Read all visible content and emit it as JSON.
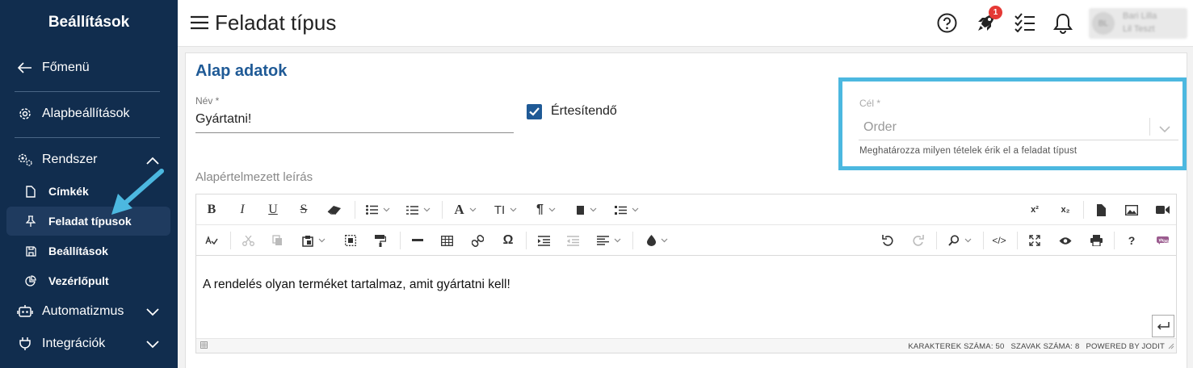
{
  "sidebar": {
    "title": "Beállítások",
    "main_menu": "Főmenü",
    "basic_settings": "Alapbeállítások",
    "system": "Rendszer",
    "subitems": [
      "Címkék",
      "Feladat típusok",
      "Beállítások",
      "Vezérlőpult"
    ],
    "active_subitem": "Feladat típusok",
    "automation": "Automatizmus",
    "integrations": "Integrációk"
  },
  "header": {
    "title": "Feladat típus",
    "notification_count": "1",
    "user_initials": "BL",
    "user_name": "Bari Lilla",
    "user_sub": "Lil Teszt"
  },
  "form": {
    "section_title": "Alap adatok",
    "name_label": "Név *",
    "name_value": "Gyártatni!",
    "notify_label": "Értesítendő",
    "notify_checked": true,
    "target_label": "Cél *",
    "target_value": "Order",
    "target_help": "Meghatározza milyen tételek érik el a feladat típust",
    "description_label": "Alapértelmezett leírás"
  },
  "editor": {
    "content": "A rendelés olyan terméket tartalmaz, amit gyártatni kell!",
    "status_chars": "KARAKTEREK SZÁMA: 50",
    "status_words": "SZAVAK SZÁMA: 8",
    "status_powered": "POWERED BY JODIT"
  },
  "colors": {
    "sidebar_bg": "#112d4e",
    "accent": "#1f5a96",
    "highlight": "#4cb8e0",
    "badge": "#e53935"
  }
}
